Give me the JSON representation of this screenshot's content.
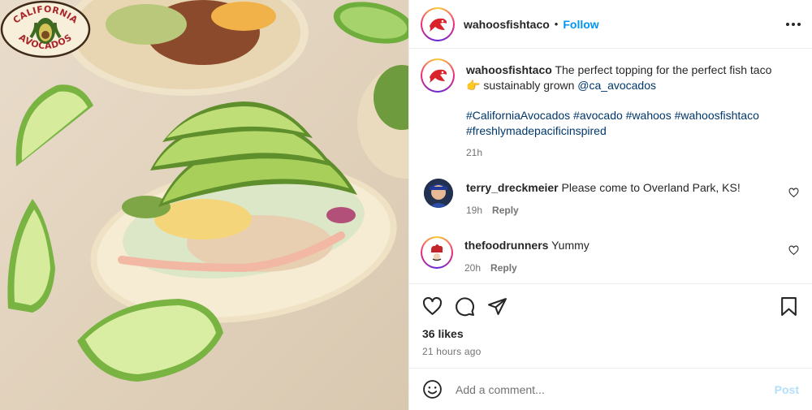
{
  "post": {
    "author": "wahoosfishtaco",
    "follow_label": "Follow",
    "separator": "•",
    "caption": {
      "username": "wahoosfishtaco",
      "text_before": "The perfect topping for the perfect fish taco 👉 sustainably grown ",
      "mention": "@ca_avocados",
      "hashtags": "#CaliforniaAvocados #avocado #wahoos #wahoosfishtaco #freshlymadepacificinspired",
      "age": "21h"
    },
    "comments": [
      {
        "username": "terry_dreckmeier",
        "text": "Please come to Overland Park, KS!",
        "age": "19h",
        "reply_label": "Reply"
      },
      {
        "username": "thefoodrunners",
        "text": "Yummy",
        "age": "20h",
        "reply_label": "Reply"
      }
    ],
    "likes": "36 likes",
    "timestamp": "21 hours ago",
    "add_comment_placeholder": "Add a comment...",
    "post_button": "Post",
    "image_badge": {
      "line1": "CALIFORNIA",
      "line2": "AVOCADOS"
    }
  },
  "icons": {
    "like": "heart-icon",
    "comment": "comment-icon",
    "share": "share-icon",
    "save": "bookmark-icon",
    "emoji": "emoji-icon",
    "more": "more-icon"
  },
  "colors": {
    "accent": "#0095f6",
    "link": "#00376b",
    "muted": "#737373",
    "post_disabled": "#b2dffc",
    "brand_red": "#d9222a"
  }
}
